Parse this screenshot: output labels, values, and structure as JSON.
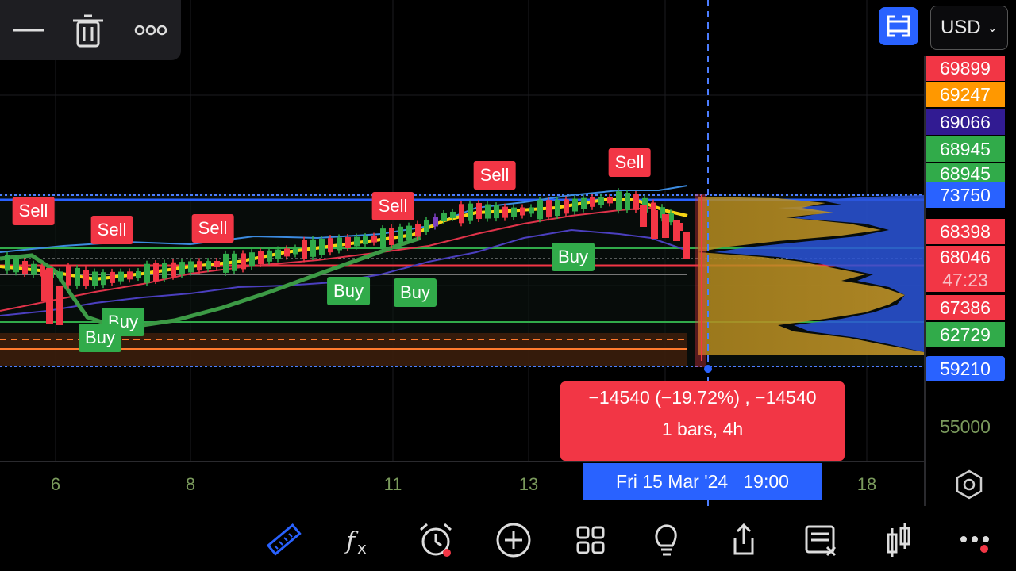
{
  "chart_data": {
    "type": "candlestick",
    "x_ticks": [
      "6",
      "8",
      "11",
      "13",
      "18"
    ],
    "y_ticks": [
      "55000"
    ],
    "price_tags": [
      {
        "value": "69899",
        "color": "#f23645"
      },
      {
        "value": "69247",
        "color": "#ff9800"
      },
      {
        "value": "69066",
        "color": "#311b92"
      },
      {
        "value": "68945",
        "color": "#31ab4a"
      },
      {
        "value": "68945",
        "color": "#31ab4a"
      },
      {
        "value": "73750",
        "color": "#2962ff"
      },
      {
        "value": "68398",
        "color": "#f23645"
      },
      {
        "value": "68046",
        "color": "#f23645"
      },
      {
        "value": "47:23",
        "color": "#f23645"
      },
      {
        "value": "67386",
        "color": "#f23645"
      },
      {
        "value": "62729",
        "color": "#31ab4a"
      },
      {
        "value": "59210",
        "color": "#2962ff"
      }
    ],
    "signals": [
      {
        "label": "Sell",
        "type": "sell"
      },
      {
        "label": "Sell",
        "type": "sell"
      },
      {
        "label": "Sell",
        "type": "sell"
      },
      {
        "label": "Sell",
        "type": "sell"
      },
      {
        "label": "Sell",
        "type": "sell"
      },
      {
        "label": "Sell",
        "type": "sell"
      },
      {
        "label": "Buy",
        "type": "buy"
      },
      {
        "label": "Buy",
        "type": "buy"
      },
      {
        "label": "Buy",
        "type": "buy"
      },
      {
        "label": "Buy",
        "type": "buy"
      },
      {
        "label": "Buy",
        "type": "buy"
      }
    ],
    "measure": {
      "line1": "−14540 (−19.72%) , −14540",
      "line2": "1 bars, 4h"
    },
    "crosshair_date": "Fri 15 Mar '24   19:00",
    "colors": {
      "up": "#31ab4a",
      "down": "#f23645",
      "highlight": "#7b3fbf",
      "accent": "#2962ff"
    }
  },
  "header": {
    "currency": "USD"
  },
  "toolbar": {
    "icons": [
      "ruler-icon",
      "fx-icon",
      "alarm-icon",
      "plus-icon",
      "grid-icon",
      "bulb-icon",
      "share-icon",
      "note-icon",
      "bars-icon",
      "more-icon"
    ]
  }
}
